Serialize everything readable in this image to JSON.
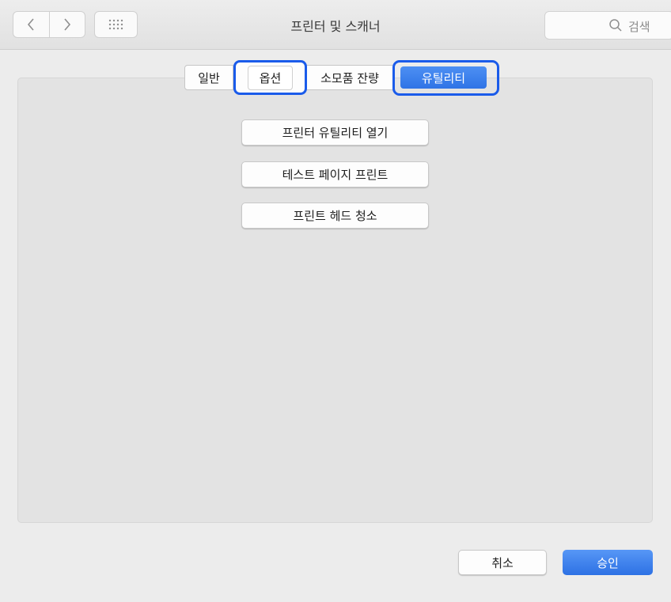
{
  "window": {
    "title": "프린터 및 스캐너"
  },
  "toolbar": {
    "back_icon": "chevron-left-icon",
    "forward_icon": "chevron-right-icon",
    "grid_icon": "grid-icon",
    "search": {
      "placeholder": "검색",
      "icon": "search-icon"
    }
  },
  "tabs": [
    {
      "label": "일반"
    },
    {
      "label": "옵션",
      "highlighted": true
    },
    {
      "label": "소모품 잔량"
    },
    {
      "label": "유틸리티",
      "selected": true,
      "highlighted": true
    }
  ],
  "actions": [
    {
      "label": "프린터 유틸리티 열기"
    },
    {
      "label": "테스트 페이지 프린트"
    },
    {
      "label": "프린트 헤드 청소"
    }
  ],
  "footer": {
    "cancel_label": "취소",
    "ok_label": "승인"
  },
  "colors": {
    "accent": "#2f74e6",
    "highlight": "#1a5bea"
  }
}
